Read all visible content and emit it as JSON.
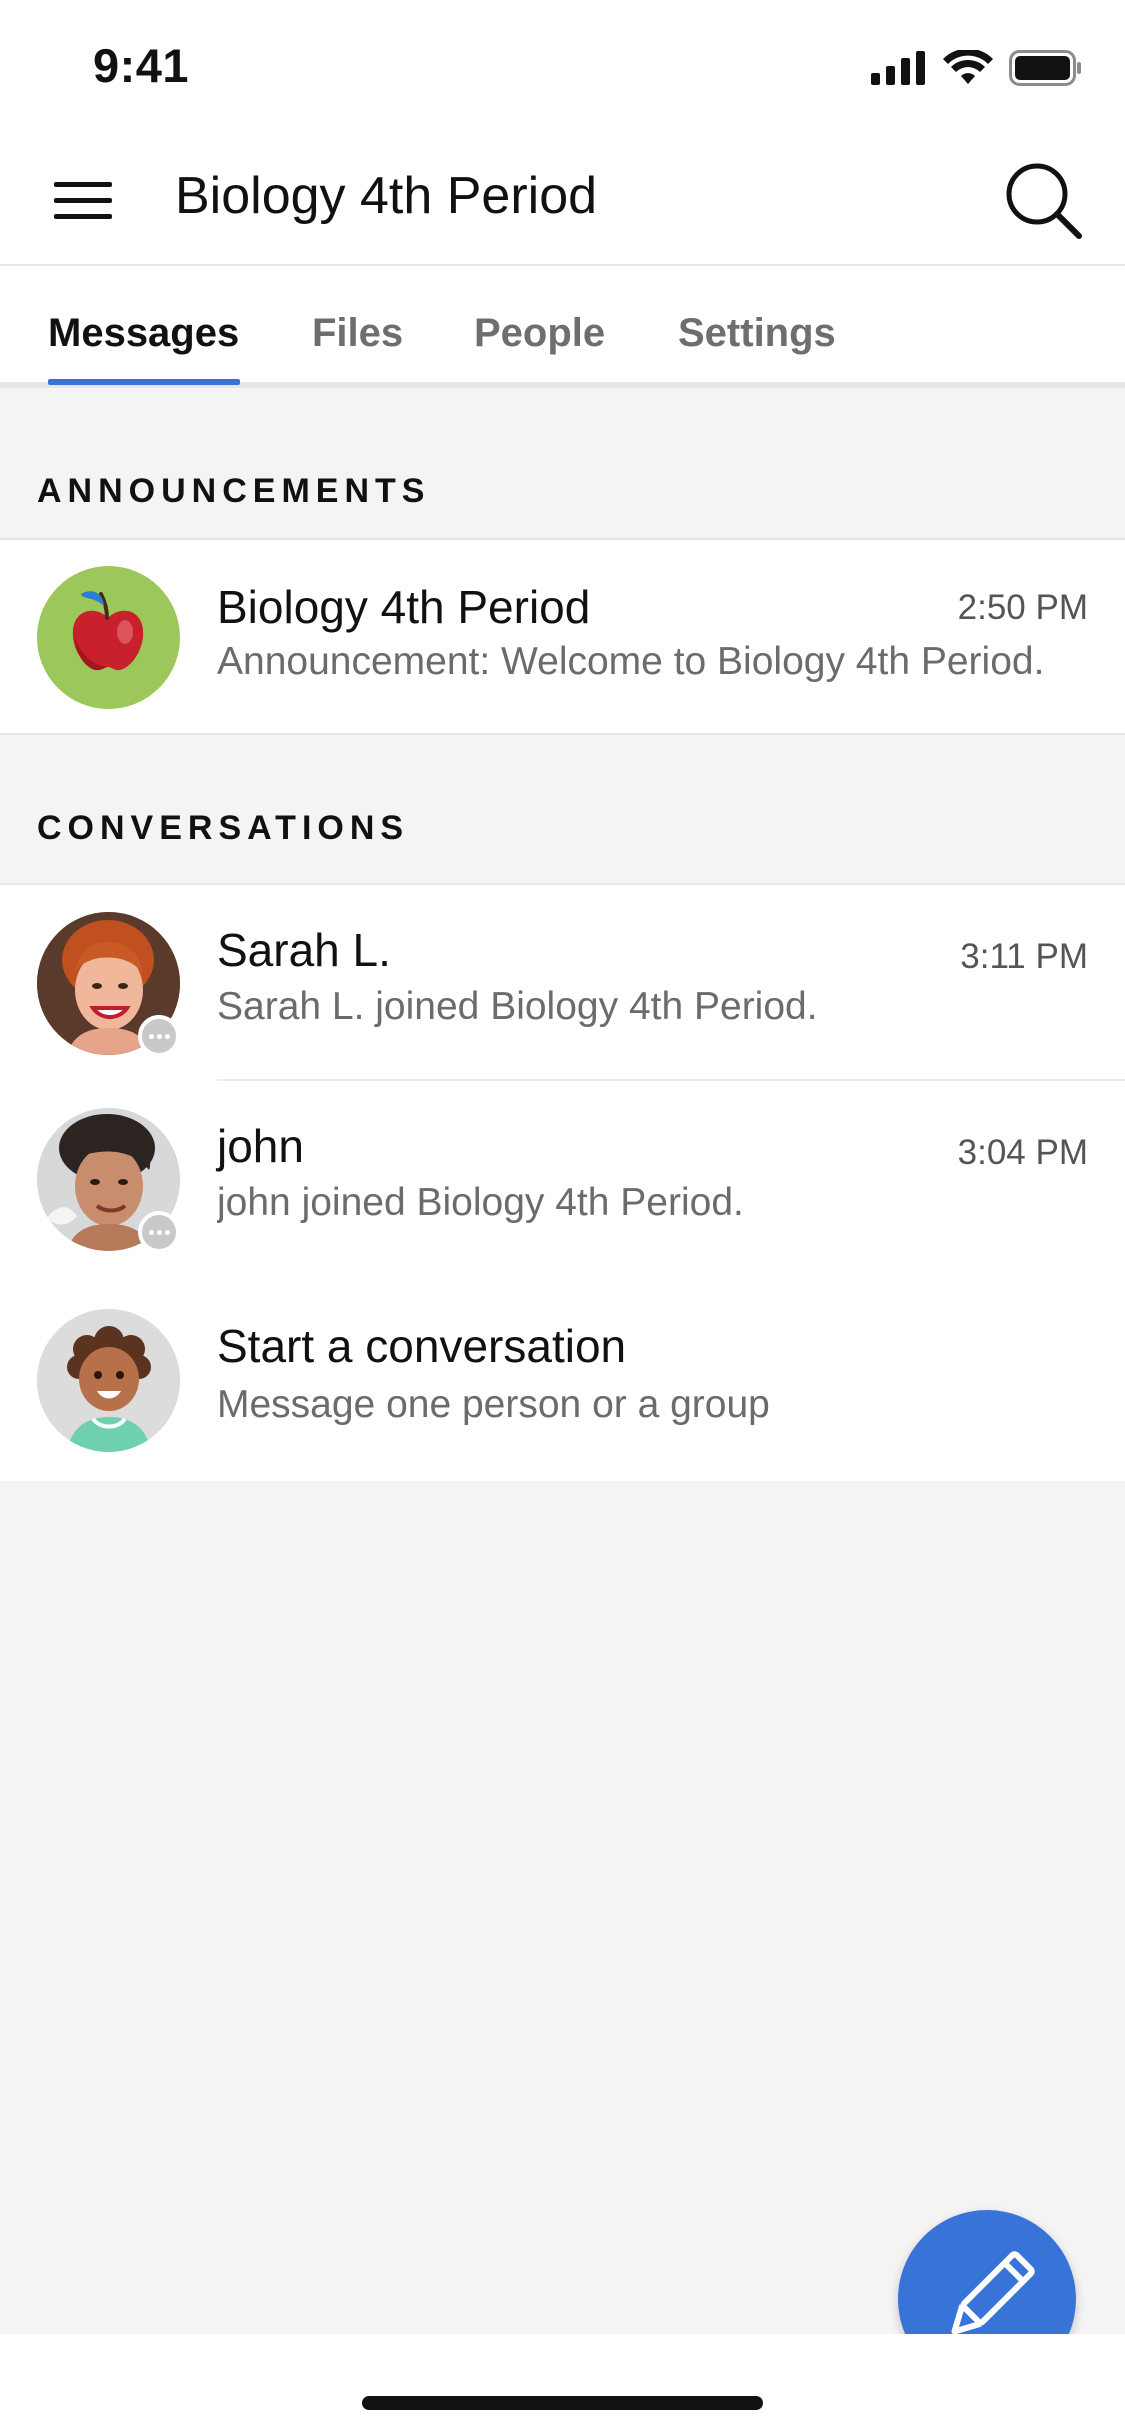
{
  "status_bar": {
    "time": "9:41"
  },
  "header": {
    "title": "Biology 4th Period",
    "menu_icon": "hamburger-menu-icon",
    "search_icon": "search-icon"
  },
  "tabs": [
    {
      "label": "Messages",
      "active": true
    },
    {
      "label": "Files",
      "active": false
    },
    {
      "label": "People",
      "active": false
    },
    {
      "label": "Settings",
      "active": false
    }
  ],
  "announcements": {
    "header": "ANNOUNCEMENTS",
    "items": [
      {
        "title": "Biology 4th Period",
        "subtitle": "Announcement: Welcome to Biology 4th Period.",
        "time": "2:50 PM",
        "avatar_icon": "apple-icon"
      }
    ]
  },
  "conversations": {
    "header": "CONVERSATIONS",
    "items": [
      {
        "title": "Sarah L.",
        "subtitle": "Sarah L. joined Biology 4th Period.",
        "time": "3:11 PM",
        "avatar": "user-avatar"
      },
      {
        "title": "john",
        "subtitle": "john joined Biology 4th Period.",
        "time": "3:04 PM",
        "avatar": "user-avatar"
      }
    ],
    "start": {
      "title": "Start a conversation",
      "subtitle": "Message one person or a group"
    }
  },
  "fab": {
    "icon": "pencil-icon"
  },
  "colors": {
    "accent": "#3873d7",
    "tab_underline": "#3a70d8",
    "background": "#f4f4f4",
    "apple_avatar_bg": "#9cc75a"
  }
}
